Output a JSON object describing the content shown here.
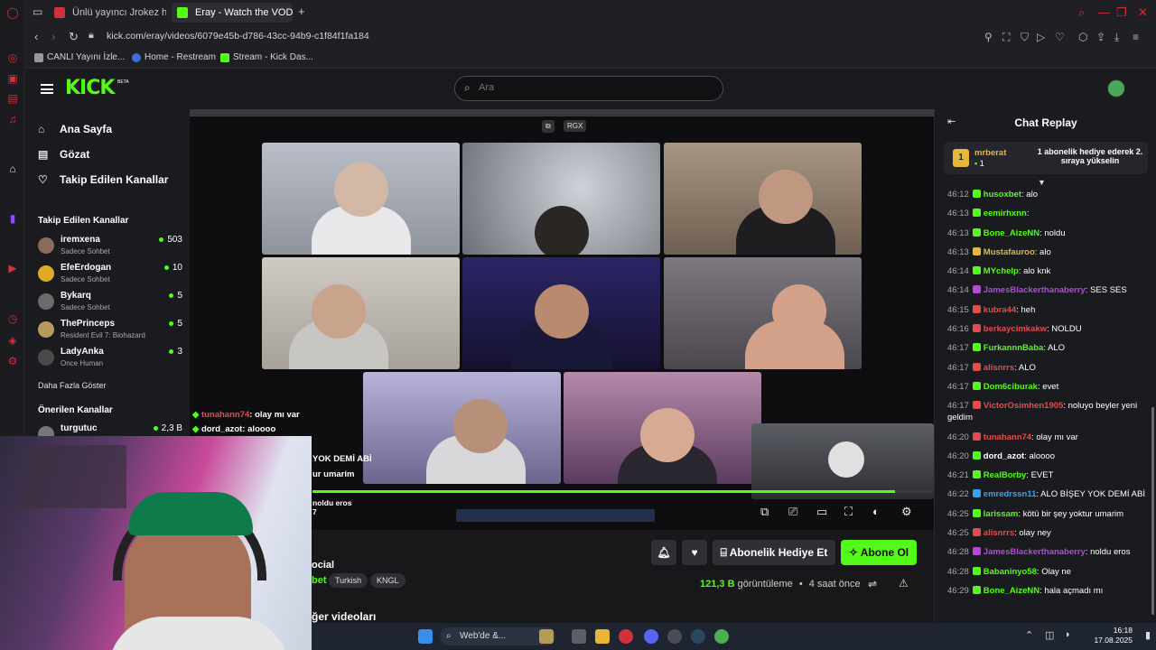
{
  "browser": {
    "tabs": [
      {
        "label": "Ünlü yayıncı Jrokez hayat",
        "favicon_color": "#d0313d"
      },
      {
        "label": "Eray - Watch the VOD on",
        "favicon_color": "#53fc18"
      }
    ],
    "url": "kick.com/eray/videos/6079e45b-d786-43cc-94b9-c1f84f1fa184",
    "bookmarks": [
      {
        "label": "CANLI Yayını İzle...",
        "color": "#999"
      },
      {
        "label": "Home - Restream",
        "color": "#3b6fd8"
      },
      {
        "label": "Stream - Kick Das...",
        "color": "#53fc18"
      }
    ]
  },
  "header": {
    "logo": "KICK",
    "beta": "BETA",
    "search_placeholder": "Ara"
  },
  "sidebar": {
    "nav": [
      {
        "label": "Ana Sayfa",
        "icon": "home-icon"
      },
      {
        "label": "Gözat",
        "icon": "browse-icon"
      },
      {
        "label": "Takip Edilen Kanallar",
        "icon": "heart-icon"
      }
    ],
    "followed_title": "Takip Edilen Kanallar",
    "followed": [
      {
        "name": "iremxena",
        "category": "Sadece Sohbet",
        "viewers": "503",
        "color": "#8a6a5a"
      },
      {
        "name": "EfeErdogan",
        "category": "Sadece Sohbet",
        "viewers": "10",
        "color": "#e0a92a"
      },
      {
        "name": "Bykarq",
        "category": "Sadece Sohbet",
        "viewers": "5",
        "color": "#6b6b6b"
      },
      {
        "name": "ThePrinceps",
        "category": "Resident Evil 7: Biohazard",
        "viewers": "5",
        "color": "#b89a5a"
      },
      {
        "name": "LadyAnka",
        "category": "Once Human",
        "viewers": "3",
        "color": "#4a4a4a"
      }
    ],
    "show_more": "Daha Fazla Göster",
    "recommended_title": "Önerilen Kanallar",
    "recommended": [
      {
        "name": "turgutuc",
        "viewers": "2,3 B"
      }
    ]
  },
  "video": {
    "progress": 0.94,
    "overlay_chat": [
      {
        "user": "tunahann74",
        "text": ": olay mı var",
        "color": "#e34d4d"
      },
      {
        "user": "dord_azot",
        "text": ": alоооо",
        "color": "#ffffff"
      }
    ],
    "overlay_fragments": [
      "YOK DEMİ ABİ",
      "ur umarim",
      "noldu eros",
      "7"
    ],
    "top_icons": [
      "RGX"
    ]
  },
  "stream_info": {
    "title_fragment": "ocial",
    "category_fragment": "bet",
    "tags": [
      "Turkish",
      "KNGL"
    ],
    "views_number": "121,3 B",
    "views_label": "görüntüleme",
    "time": "4 saat önce",
    "gift_button": "Abonelik Hediye Et",
    "subscribe_button": "Abone Ol",
    "videos_heading": "ğer videoları"
  },
  "chat": {
    "title": "Chat Replay",
    "pinned": {
      "badge": "1",
      "user": "mrberat",
      "count": "1",
      "text": "1 abonelik hediye ederek 2. sıraya yükselin"
    },
    "messages": [
      {
        "time": "46:12",
        "user": "husoxbet",
        "text": ": alo",
        "color": "#53fc18"
      },
      {
        "time": "46:13",
        "user": "eemirhxnn",
        "text": ":",
        "color": "#53fc18"
      },
      {
        "time": "46:13",
        "user": "Bone_AizeNN",
        "text": ": noldu",
        "color": "#53fc18"
      },
      {
        "time": "46:13",
        "user": "Mustafauroo",
        "text": ": alo",
        "color": "#e8b63a"
      },
      {
        "time": "46:14",
        "user": "MYchelp",
        "text": ": alo knk",
        "color": "#53fc18"
      },
      {
        "time": "46:14",
        "user": "JamesBlackerthanaberry",
        "text": ": SES SES",
        "color": "#b44ad8"
      },
      {
        "time": "46:15",
        "user": "kubra44",
        "text": ": heh",
        "color": "#e34d4d"
      },
      {
        "time": "46:16",
        "user": "berkaycimkakw",
        "text": ": NOLDU",
        "color": "#e34d4d"
      },
      {
        "time": "46:17",
        "user": "FurkannnBaba",
        "text": ": ALO",
        "color": "#53fc18"
      },
      {
        "time": "46:17",
        "user": "alisnrrs",
        "text": ": ALO",
        "color": "#e34d4d"
      },
      {
        "time": "46:17",
        "user": "Dom6ciburak",
        "text": ": evet",
        "color": "#53fc18"
      },
      {
        "time": "46:17",
        "user": "VictorOsimhen1905",
        "text": ": noluyo beyler yeni geldim",
        "color": "#e34d4d"
      },
      {
        "time": "46:20",
        "user": "tunahann74",
        "text": ": olay mı var",
        "color": "#e34d4d"
      },
      {
        "time": "46:20",
        "user": "dord_azot",
        "text": ": alоооо",
        "color": "#ffffff"
      },
      {
        "time": "46:21",
        "user": "RealBorby",
        "text": ": EVET",
        "color": "#53fc18"
      },
      {
        "time": "46:22",
        "user": "emredrssn11",
        "text": ": ALO BİŞEY YOK DEMİ ABİ",
        "color": "#3aa4e8"
      },
      {
        "time": "46:25",
        "user": "larissam",
        "text": ": kötü bir şey yoktur umarim",
        "color": "#53fc18"
      },
      {
        "time": "46:25",
        "user": "alisnrrs",
        "text": ": olay ney",
        "color": "#e34d4d"
      },
      {
        "time": "46:28",
        "user": "JamesBlackerthanaberry",
        "text": ": noldu eros",
        "color": "#b44ad8"
      },
      {
        "time": "46:28",
        "user": "Babaninyo58",
        "text": ": Olay ne",
        "color": "#53fc18"
      },
      {
        "time": "46:29",
        "user": "Bone_AizeNN",
        "text": ": hala açmadı mı",
        "color": "#53fc18"
      }
    ]
  },
  "taskbar": {
    "search": "Web'de &...",
    "time": "16:18",
    "date": "17.08.2025"
  }
}
